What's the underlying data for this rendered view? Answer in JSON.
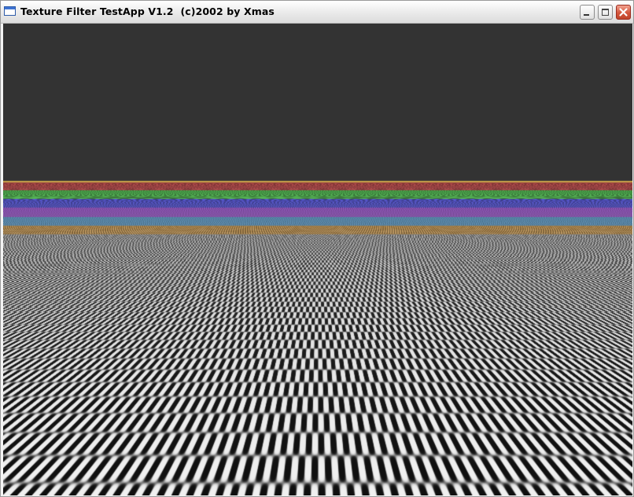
{
  "window": {
    "title": "Texture Filter TestApp V1.2  (c)2002 by Xmas"
  },
  "controls": {
    "minimize_icon": "minimize-icon",
    "maximize_icon": "maximize-icon",
    "close_icon": "close-icon"
  },
  "scene": {
    "background_color": "#333333",
    "floor_pattern": "checkerboard",
    "checker_colors": [
      "#ffffff",
      "#000000"
    ],
    "mip_tint_colors": [
      "#ff9900",
      "#33aaff",
      "#aa33ff",
      "#3333ff",
      "#33cc33",
      "#cc3333"
    ]
  }
}
